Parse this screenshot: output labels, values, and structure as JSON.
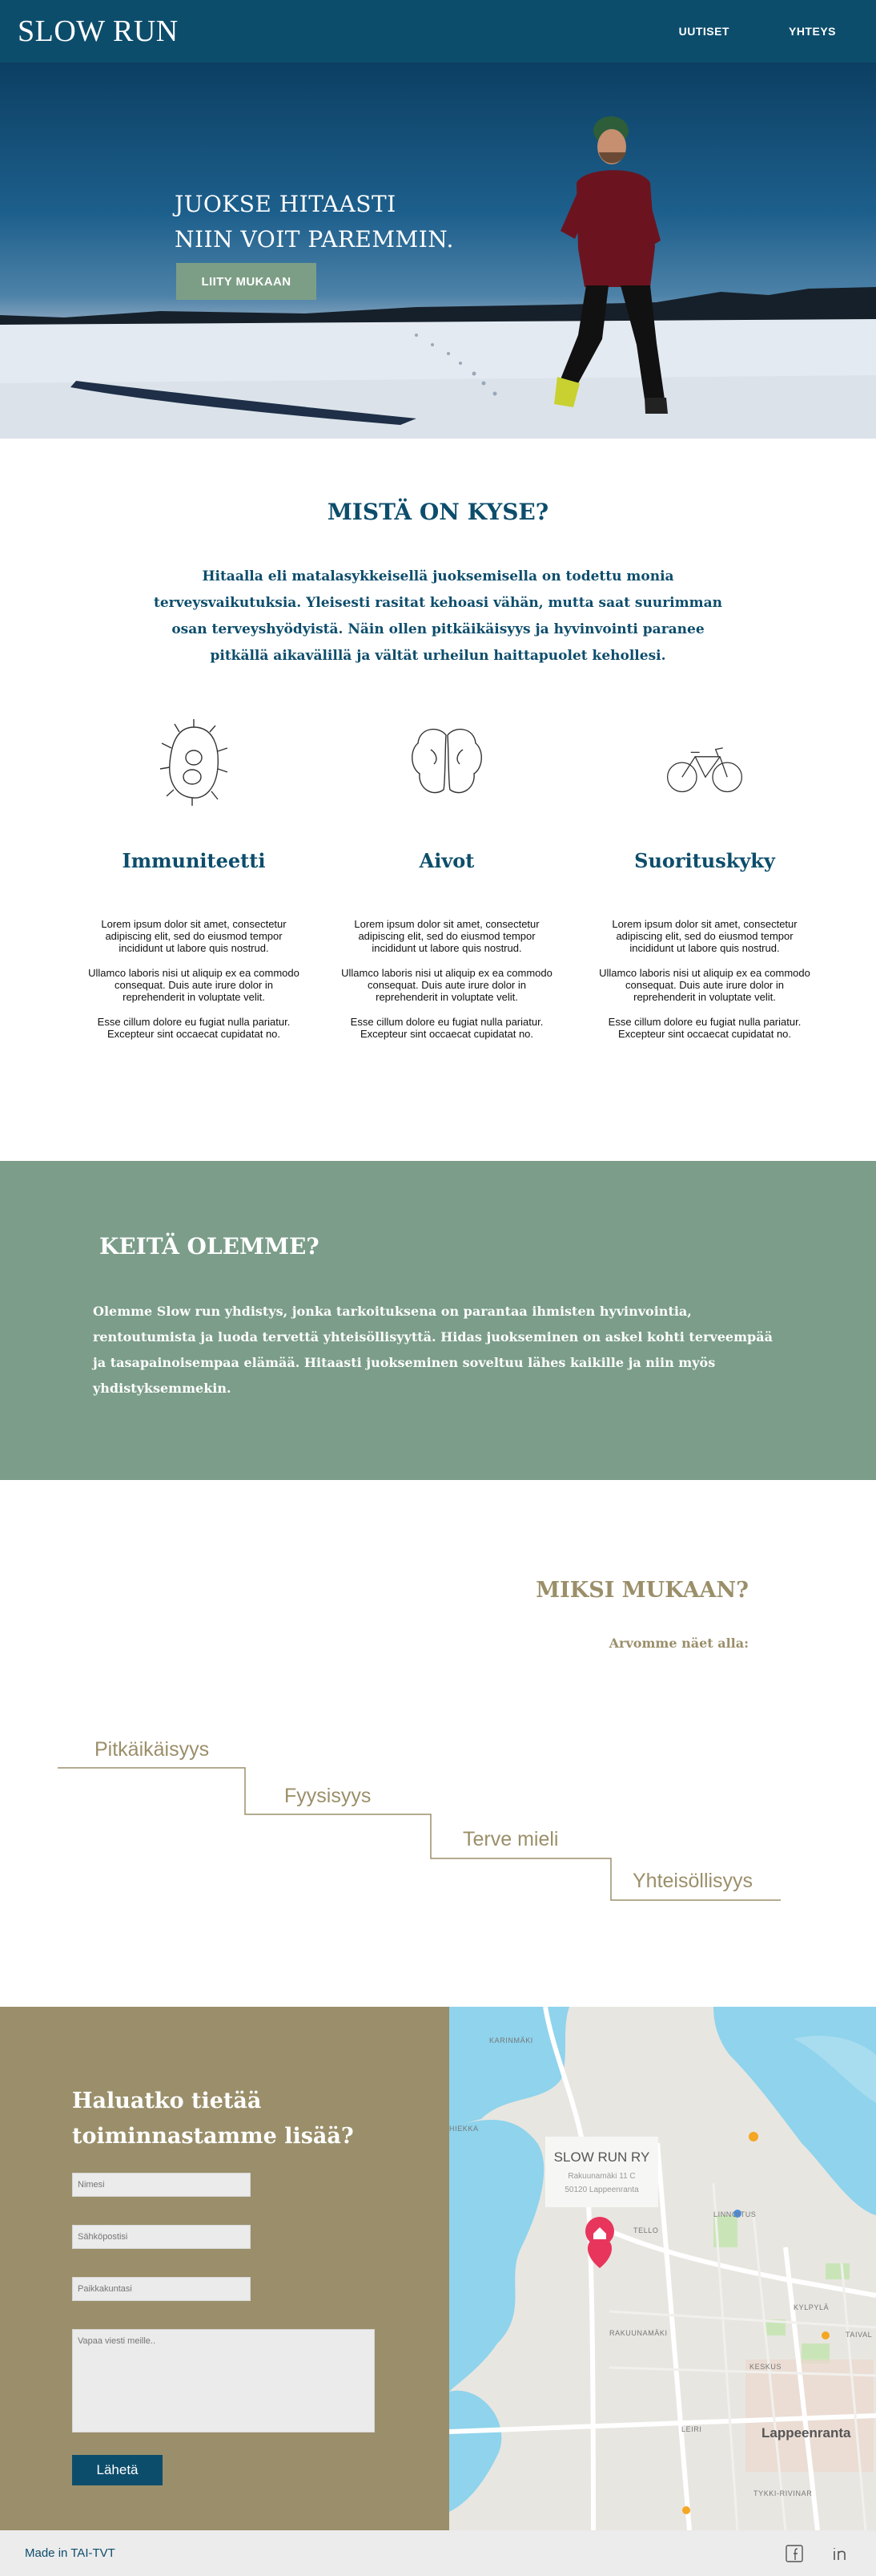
{
  "header": {
    "logo": "SLOW RUN",
    "nav": [
      {
        "label": "UUTISET"
      },
      {
        "label": "YHTEYS"
      }
    ]
  },
  "hero": {
    "title_line1": "JUOKSE HITAASTI",
    "title_line2": "NIIN VOIT PAREMMIN.",
    "cta": "LIITY MUKAAN"
  },
  "about": {
    "title": "MISTÄ ON KYSE?",
    "intro": "Hitaalla eli matalasykkeisellä juoksemisella on todettu monia terveysvaikutuksia. Yleisesti rasitat kehoasi vähän, mutta saat suurimman osan terveyshyödyistä. Näin ollen pitkäikäisyys ja hyvinvointi paranee pitkällä aikavälillä ja vältät urheilun haittapuolet kehollesi.",
    "features": [
      {
        "title": "Immuniteetti",
        "icon": "cell-icon",
        "p1": "Lorem ipsum dolor sit amet, consectetur adipiscing elit, sed do eiusmod tempor incididunt ut labore quis nostrud.",
        "p2": "Ullamco laboris nisi ut aliquip ex ea commodo consequat. Duis aute irure dolor in reprehenderit in voluptate velit.",
        "p3": "Esse cillum dolore eu fugiat nulla pariatur. Excepteur sint occaecat cupidatat no."
      },
      {
        "title": "Aivot",
        "icon": "brain-icon",
        "p1": "Lorem ipsum dolor sit amet, consectetur adipiscing elit, sed do eiusmod tempor incididunt ut labore quis nostrud.",
        "p2": "Ullamco laboris nisi ut aliquip ex ea commodo consequat. Duis aute irure dolor in reprehenderit in voluptate velit.",
        "p3": "Esse cillum dolore eu fugiat nulla pariatur. Excepteur sint occaecat cupidatat no."
      },
      {
        "title": "Suorituskyky",
        "icon": "bicycle-icon",
        "p1": "Lorem ipsum dolor sit amet, consectetur adipiscing elit, sed do eiusmod tempor incididunt ut labore quis nostrud.",
        "p2": "Ullamco laboris nisi ut aliquip ex ea commodo consequat. Duis aute irure dolor in reprehenderit in voluptate velit.",
        "p3": "Esse cillum dolore eu fugiat nulla pariatur. Excepteur sint occaecat cupidatat no."
      }
    ]
  },
  "who": {
    "title": "KEITÄ OLEMME?",
    "text": "Olemme Slow run yhdistys, jonka tarkoituksena on parantaa ihmisten hyvinvointia, rentoutumista ja luoda tervettä yhteisöllisyyttä. Hidas juokseminen on askel kohti terveempää ja tasapainoisempaa elämää. Hitaasti juokseminen soveltuu lähes kaikille ja niin myös yhdistyksemmekin."
  },
  "why": {
    "title": "MIKSI MUKAAN?",
    "subtitle": "Arvomme näet alla:",
    "values": [
      "Pitkäikäisyys",
      "Fyysisyys",
      "Terve mieli",
      "Yhteisöllisyys"
    ]
  },
  "contact": {
    "title_line1": "Haluatko tietää",
    "title_line2": "toiminnastamme lisää?",
    "name_placeholder": "Nimesi",
    "email_placeholder": "Sähköpostisi",
    "city_placeholder": "Paikkakuntasi",
    "message_placeholder": "Vapaa viesti meille..",
    "submit": "Lähetä"
  },
  "map": {
    "place_name": "SLOW RUN RY",
    "address": "Rakuunamäki 11 C",
    "postal": "50120 Lappeenranta",
    "city_label": "Lappeenranta",
    "labels": [
      "KARINMÄKI",
      "LINNOITUS",
      "RAKUUNAMÄKI",
      "KESKUS",
      "LEIRI",
      "TYKKI-RIVINAR",
      "KYLPYLÄ",
      "TAIVAL",
      "HIEKKA",
      "TELLO"
    ]
  },
  "footer": {
    "made": "Made in TAI-TVT",
    "icons": [
      "facebook-icon",
      "linkedin-icon"
    ]
  },
  "colors": {
    "primary": "#0d4d6c",
    "green": "#7b9d89",
    "gold": "#9b8f6a"
  }
}
